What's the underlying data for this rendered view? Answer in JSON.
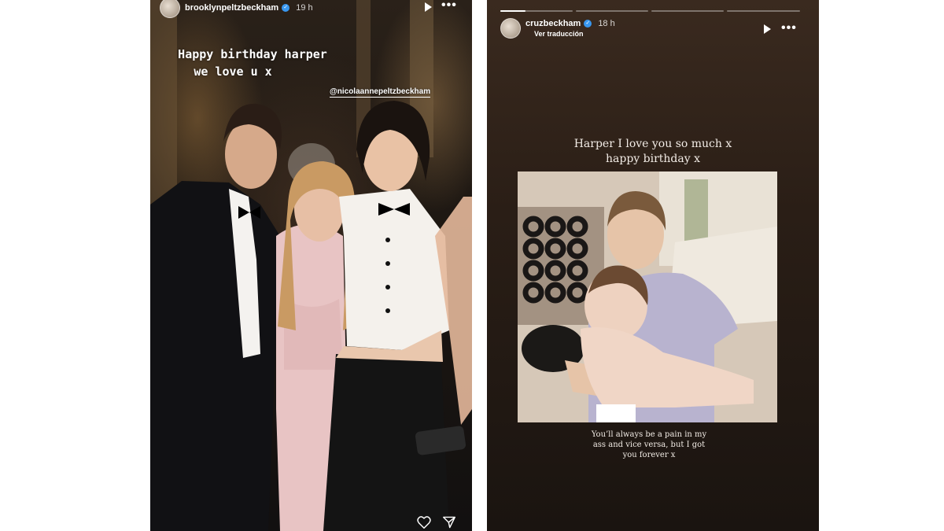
{
  "story_left": {
    "username": "brooklynpeltzbeckham",
    "time": "19 h",
    "text_line1": "Happy birthday harper",
    "text_line2": "we love u x",
    "mention": "@nicolaannepeltzbeckham",
    "icons": [
      "play-icon",
      "more-icon",
      "heart-icon",
      "send-icon"
    ]
  },
  "story_right": {
    "username": "cruzbeckham",
    "time": "18 h",
    "translation_link": "Ver traducción",
    "title_line1": "Harper I love you so much x",
    "title_line2": "happy birthday x",
    "caption_line1": "You’ll always be a pain in my",
    "caption_line2": "ass and vice versa, but I got",
    "caption_line3": "you forever x",
    "progress_segments": 4,
    "progress_active_fraction": 0.35,
    "icons": [
      "play-icon",
      "more-icon"
    ]
  }
}
